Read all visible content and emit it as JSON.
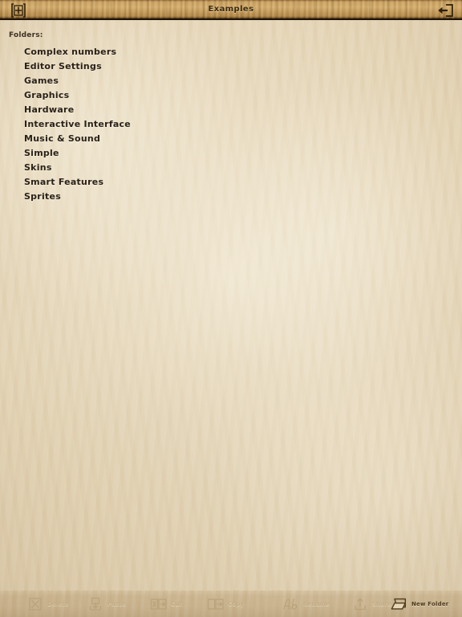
{
  "topbar": {
    "title": "Examples",
    "left_icon": "add-plus-icon",
    "right_icon": "exit-arrow-icon"
  },
  "content": {
    "section_label": "Folders:",
    "folders": [
      {
        "name": "Complex numbers"
      },
      {
        "name": "Editor Settings"
      },
      {
        "name": "Games"
      },
      {
        "name": "Graphics"
      },
      {
        "name": "Hardware"
      },
      {
        "name": "Interactive Interface"
      },
      {
        "name": "Music & Sound"
      },
      {
        "name": "Simple"
      },
      {
        "name": "Skins"
      },
      {
        "name": "Smart Features"
      },
      {
        "name": "Sprites"
      }
    ]
  },
  "bottombar": {
    "tools": [
      {
        "label": "Delete",
        "icon": "delete-x-box-icon",
        "state": "disabled"
      },
      {
        "label": "Paste",
        "icon": "paste-icon",
        "state": "disabled"
      },
      {
        "label": "Cut",
        "icon": "cut-icon",
        "state": "disabled"
      },
      {
        "label": "Copy",
        "icon": "copy-icon",
        "state": "disabled"
      },
      {
        "label": "Rename",
        "icon": "rename-ab-icon",
        "state": "disabled"
      },
      {
        "label": "Share",
        "icon": "share-upload-icon",
        "state": "disabled"
      },
      {
        "label": "New Folder",
        "icon": "new-folder-icon",
        "state": "active"
      }
    ]
  },
  "colors": {
    "paper": "#ddcbaa",
    "wood": "#c9a263",
    "text_dark": "#2a2118",
    "tool_disabled": "#c2ab84",
    "tool_active": "#4c3a1c"
  }
}
